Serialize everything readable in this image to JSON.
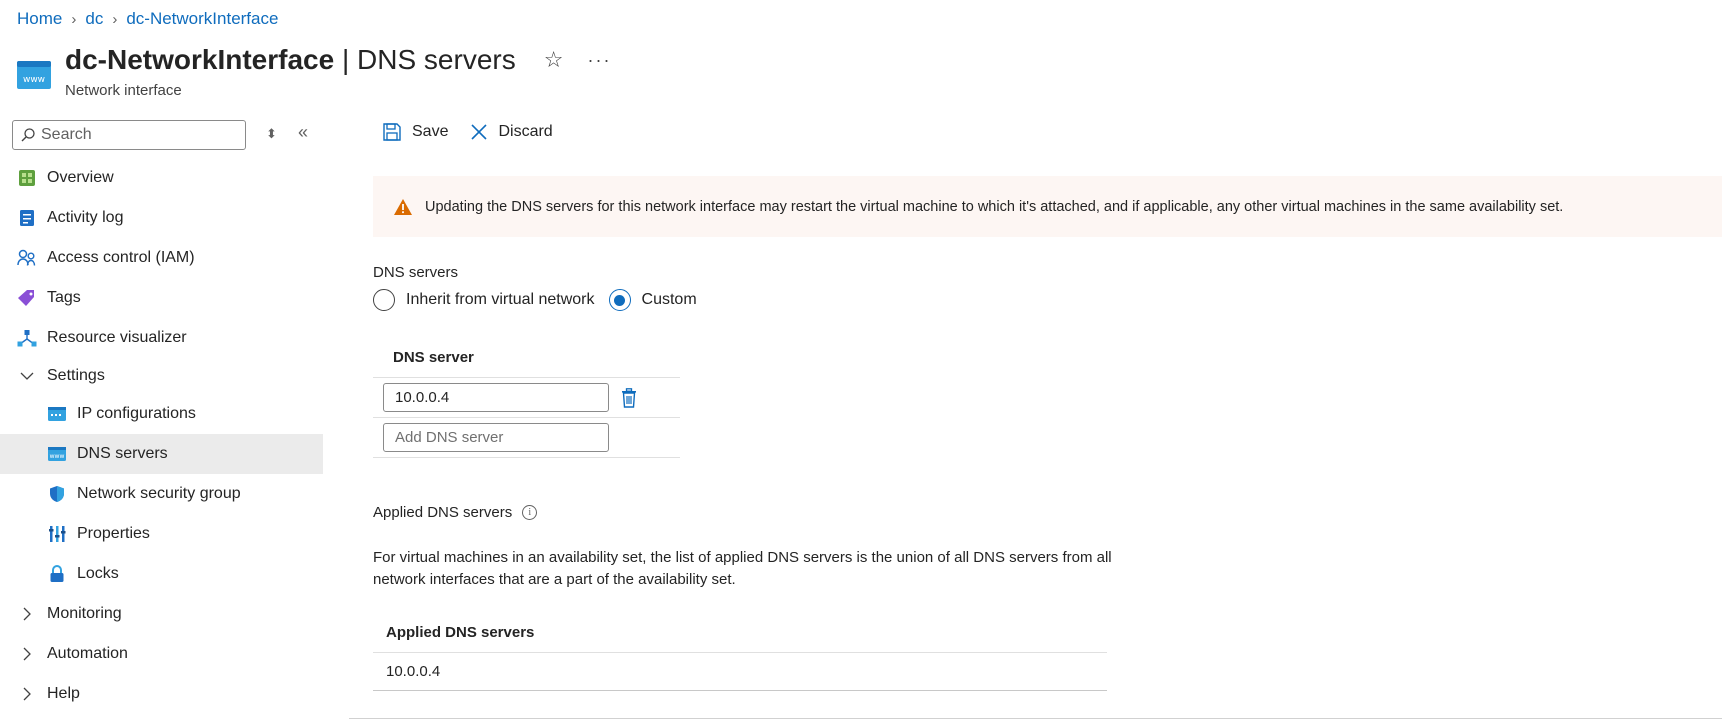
{
  "breadcrumb": {
    "items": [
      "Home",
      "dc",
      "dc-NetworkInterface"
    ]
  },
  "header": {
    "resource_name": "dc-NetworkInterface",
    "page_name": "DNS servers",
    "separator": " | ",
    "subtitle": "Network interface"
  },
  "sidebar": {
    "search_placeholder": "Search",
    "items": [
      {
        "label": "Overview"
      },
      {
        "label": "Activity log"
      },
      {
        "label": "Access control (IAM)"
      },
      {
        "label": "Tags"
      },
      {
        "label": "Resource visualizer"
      },
      {
        "label": "Settings"
      },
      {
        "label": "IP configurations"
      },
      {
        "label": "DNS servers"
      },
      {
        "label": "Network security group"
      },
      {
        "label": "Properties"
      },
      {
        "label": "Locks"
      },
      {
        "label": "Monitoring"
      },
      {
        "label": "Automation"
      },
      {
        "label": "Help"
      }
    ]
  },
  "toolbar": {
    "save_label": "Save",
    "discard_label": "Discard"
  },
  "warning": {
    "text": "Updating the DNS servers for this network interface may restart the virtual machine to which it's attached, and if applicable, any other virtual machines in the same availability set."
  },
  "dns": {
    "label": "DNS servers",
    "option_inherit": "Inherit from virtual network",
    "option_custom": "Custom",
    "selected": "Custom",
    "table_header": "DNS server",
    "server_value": "10.0.0.4",
    "add_placeholder": "Add DNS server"
  },
  "applied": {
    "label": "Applied DNS servers",
    "description": "For virtual machines in an availability set, the list of applied DNS servers is the union of all DNS servers from all network interfaces that are a part of the availability set.",
    "table_header": "Applied DNS servers",
    "rows": [
      "10.0.0.4"
    ]
  },
  "colors": {
    "accent": "#0f6cbd",
    "warning_bg": "#fdf6f3",
    "warning_icon": "#da6b00",
    "active_bg": "#ebebeb"
  }
}
